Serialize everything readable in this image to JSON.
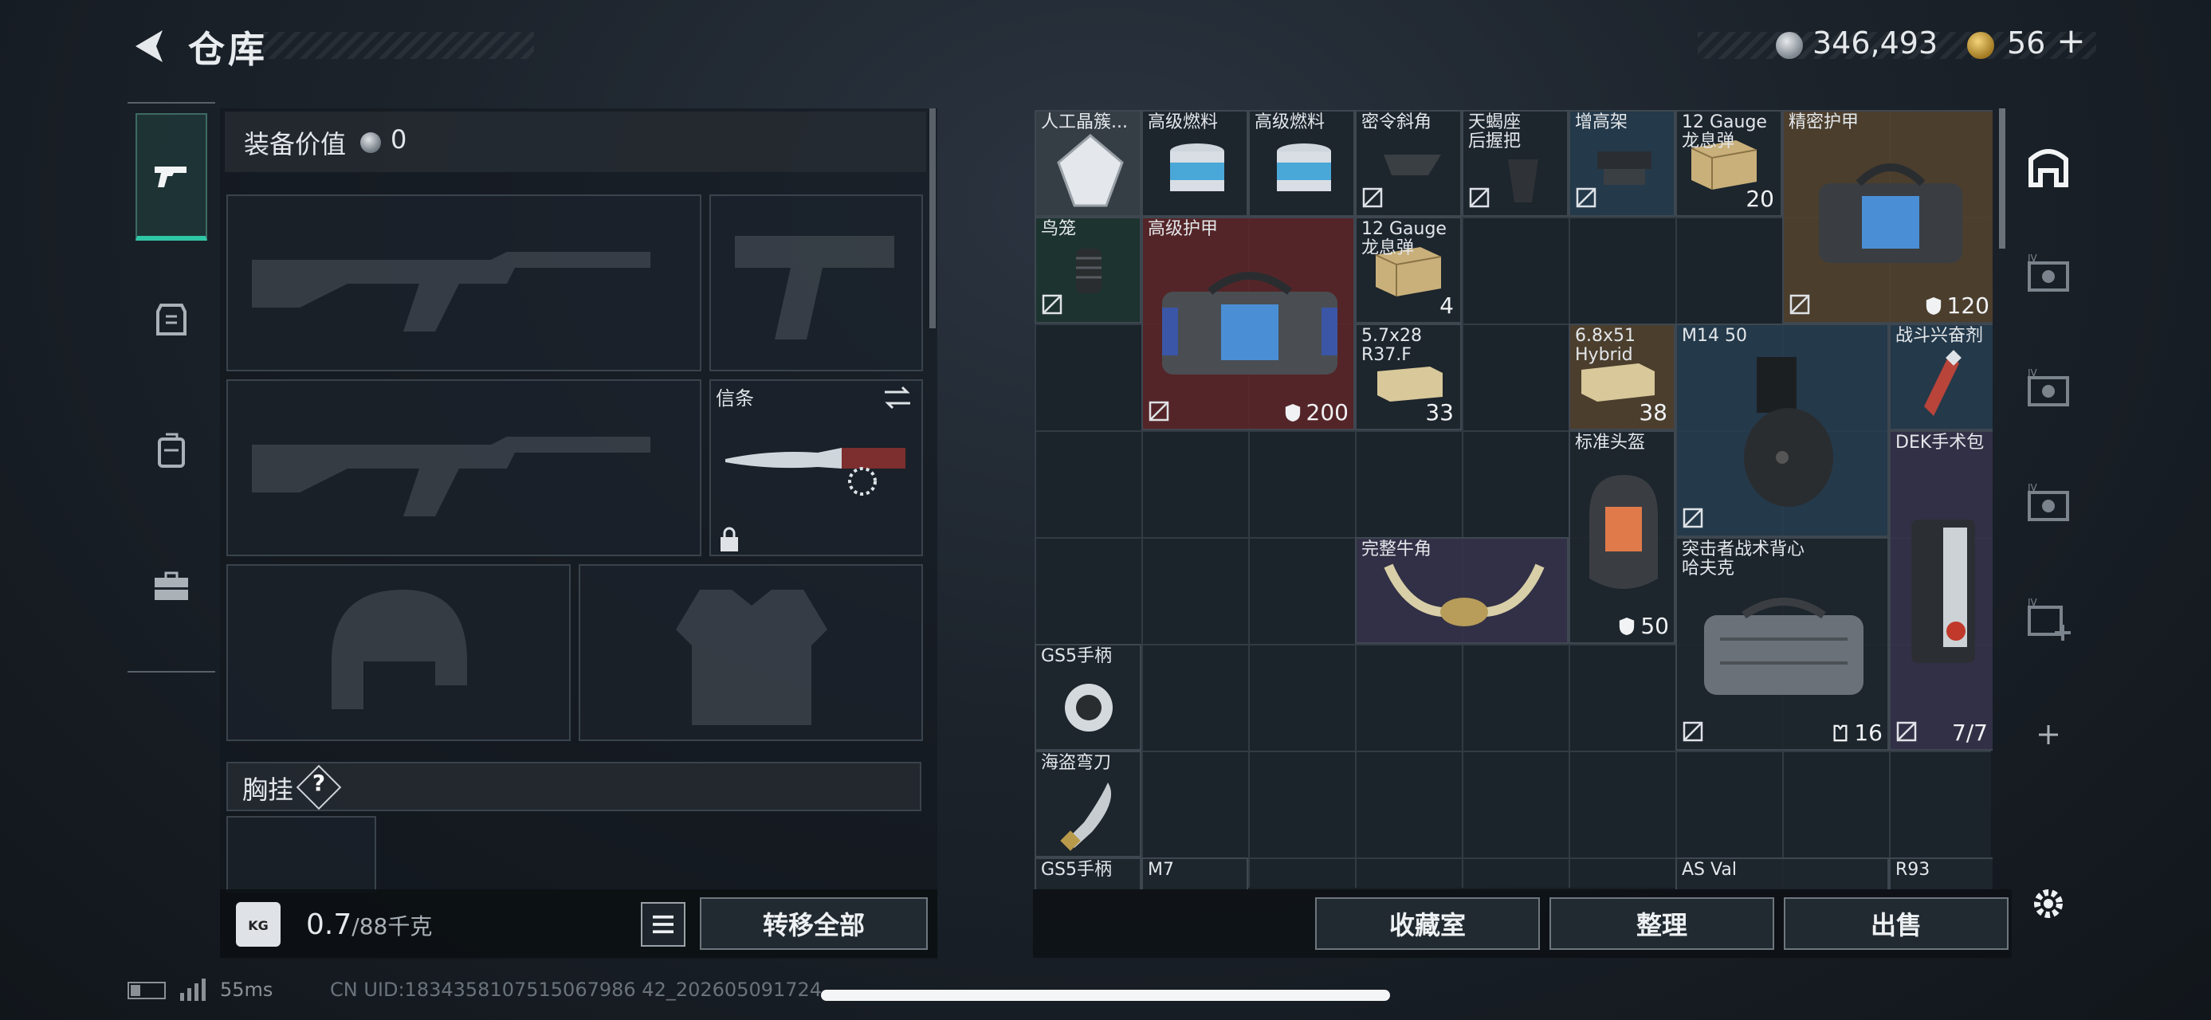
{
  "header": {
    "title": "仓库"
  },
  "currency": {
    "silver": "346,493",
    "gold": "56",
    "plus": "+"
  },
  "equipment": {
    "value_label": "装备价值",
    "value": "0",
    "knife_name": "信条",
    "vest_label": "胸挂",
    "vest_help": "?"
  },
  "weight": {
    "icon_label": "KG",
    "value": "0.7",
    "unit": "/88千克"
  },
  "actions": {
    "move_all": "转移全部",
    "collection": "收藏室",
    "sort": "整理",
    "sell": "出售"
  },
  "grid_items": [
    {
      "name": "人工晶簇...",
      "count": ""
    },
    {
      "name": "高级燃料",
      "count": ""
    },
    {
      "name": "高级燃料",
      "count": ""
    },
    {
      "name": "密令斜角",
      "count": ""
    },
    {
      "name": "天蝎座\n后握把",
      "count": ""
    },
    {
      "name": "增高架",
      "count": ""
    },
    {
      "name": "12 Gauge\n龙息弹",
      "count": "20"
    },
    {
      "name": "精密护甲",
      "count": "120"
    },
    {
      "name": "鸟笼",
      "count": ""
    },
    {
      "name": "高级护甲",
      "count": "200"
    },
    {
      "name": "12 Gauge\n龙息弹",
      "count": "4"
    },
    {
      "name": "5.7x28\nR37.F",
      "count": "33"
    },
    {
      "name": "6.8x51\nHybrid",
      "count": "38"
    },
    {
      "name": "M14 50",
      "count": ""
    },
    {
      "name": "战斗兴奋剂",
      "count": ""
    },
    {
      "name": "标准头盔",
      "count": "50"
    },
    {
      "name": "DEK手术包",
      "count": "7/7"
    },
    {
      "name": "完整牛角",
      "count": ""
    },
    {
      "name": "突击者战术背心\n哈夫克",
      "count": "16"
    },
    {
      "name": "GS5手柄",
      "count": ""
    },
    {
      "name": "海盗弯刀",
      "count": ""
    },
    {
      "name": "GS5手柄",
      "count": ""
    },
    {
      "name": "M7",
      "count": ""
    },
    {
      "name": "AS Val",
      "count": ""
    },
    {
      "name": "R93",
      "count": ""
    }
  ],
  "status": {
    "ping": "55ms",
    "uid": "CN UID:1834358107515067986 42_202605091724"
  },
  "colors": {
    "accent": "#2fc6a6",
    "panel": "#1b232b",
    "rarity_red": "#5c2628",
    "rarity_gold": "#524230",
    "rarity_blue": "#263c4e"
  }
}
